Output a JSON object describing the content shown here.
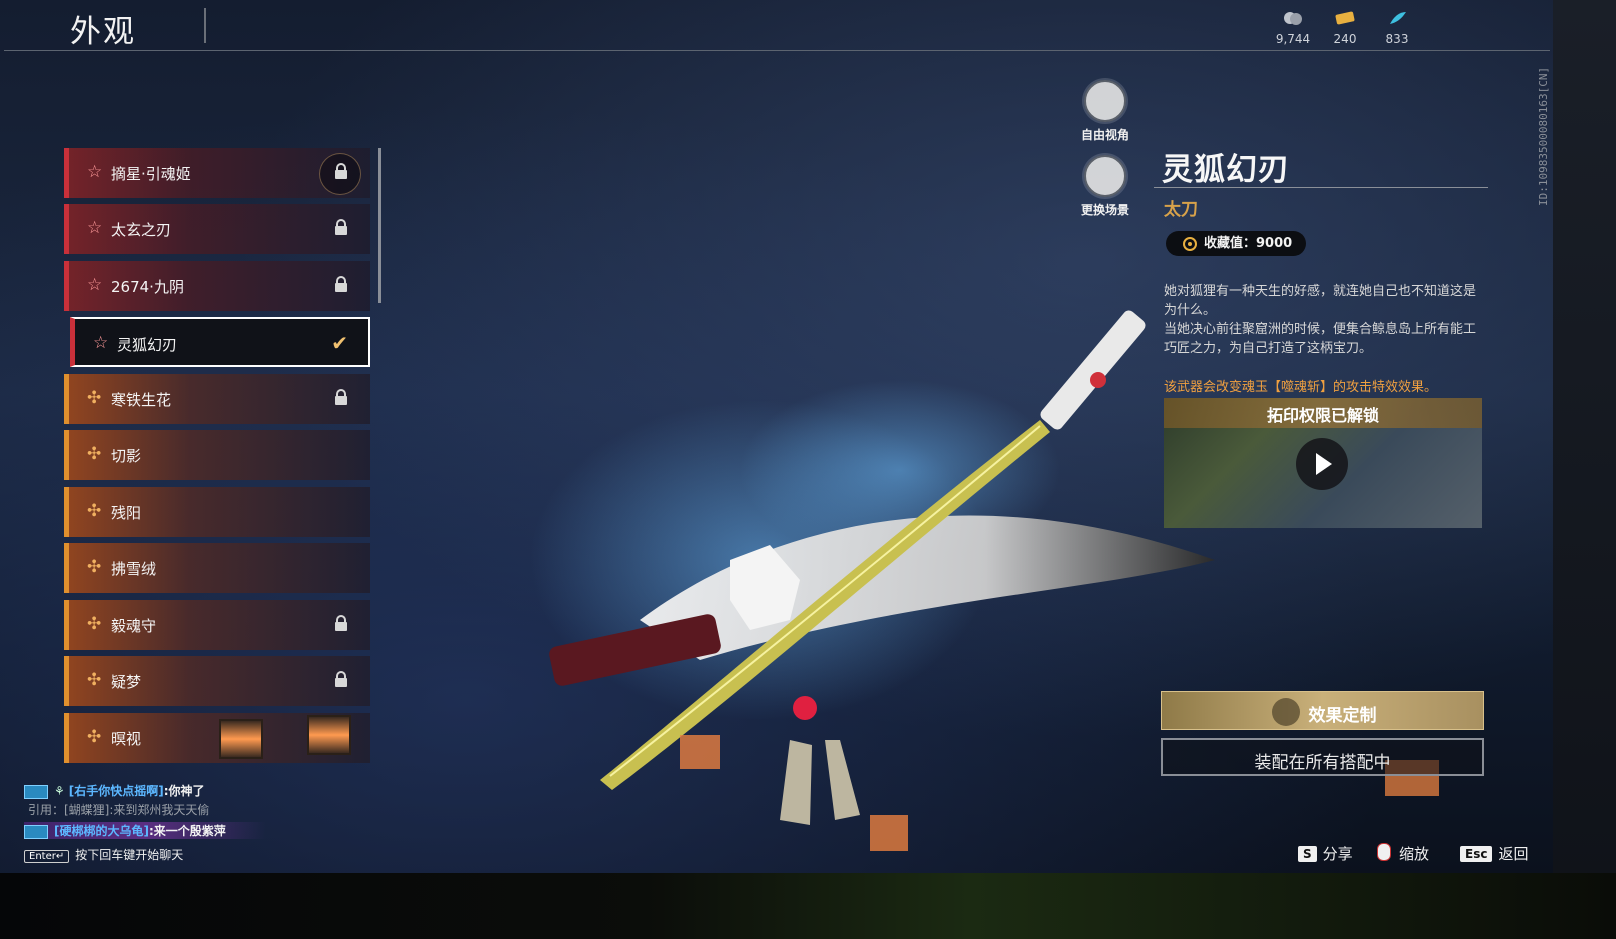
{
  "header": {
    "title": "外观"
  },
  "currencies": [
    {
      "icon": "coin-bag-icon",
      "value": "9,744"
    },
    {
      "icon": "gold-ticket-icon",
      "value": "240"
    },
    {
      "icon": "feather-token-icon",
      "value": "833"
    }
  ],
  "skins": [
    {
      "name": "摘星·引魂姬",
      "rarity": "red",
      "status": "locked"
    },
    {
      "name": "太玄之刃",
      "rarity": "red",
      "status": "locked"
    },
    {
      "name": "2674·九阴",
      "rarity": "red",
      "status": "locked"
    },
    {
      "name": "灵狐幻刃",
      "rarity": "red",
      "status": "selected"
    },
    {
      "name": "寒铁生花",
      "rarity": "orange",
      "status": "locked"
    },
    {
      "name": "切影",
      "rarity": "orange",
      "status": "owned"
    },
    {
      "name": "残阳",
      "rarity": "orange",
      "status": "owned"
    },
    {
      "name": "拂雪绒",
      "rarity": "orange",
      "status": "owned"
    },
    {
      "name": "毅魂守",
      "rarity": "orange",
      "status": "locked"
    },
    {
      "name": "疑梦",
      "rarity": "orange",
      "status": "locked"
    },
    {
      "name": "暝视",
      "rarity": "orange",
      "status": "owned"
    }
  ],
  "camera": {
    "free_view": "自由视角",
    "change_scene": "更换场景"
  },
  "item": {
    "name": "灵狐幻刃",
    "type": "太刀",
    "collection": "收藏值：9000",
    "desc_1": "她对狐狸有一种天生的好感，就连她自己也不知道这是为什么。",
    "desc_2": "当她决心前往聚窟洲的时候，便集合鲸息岛上所有能工巧匠之力，为自己打造了这柄宝刀。",
    "note": "该武器会改变魂玉【噬魂斩】的攻击特效效果。",
    "video_title": "拓印权限已解锁",
    "custom_button": "效果定制",
    "equip_button": "装配在所有搭配中"
  },
  "chat": {
    "line1_name": "[右手你快点摇啊]",
    "line1_msg": ":你神了",
    "quote": "引用：[蝴蝶狸]:来到郑州我天天偷",
    "line2_name": "[硬梆梆的大乌龟]",
    "line2_msg": ":来一个殷紫萍",
    "enter_key": "Enter↵",
    "enter_hint": "按下回车键开始聊天"
  },
  "hints": {
    "share_key": "S",
    "share": "分享",
    "zoom": "缩放",
    "back_key": "Esc",
    "back": "返回"
  },
  "side_id": "ID:10983500080163[CN]",
  "colors": {
    "red_rarity": "#c9303a",
    "orange_rarity": "#e0902e",
    "type_gold": "#d8a24a",
    "note_orange": "#f0a040"
  }
}
